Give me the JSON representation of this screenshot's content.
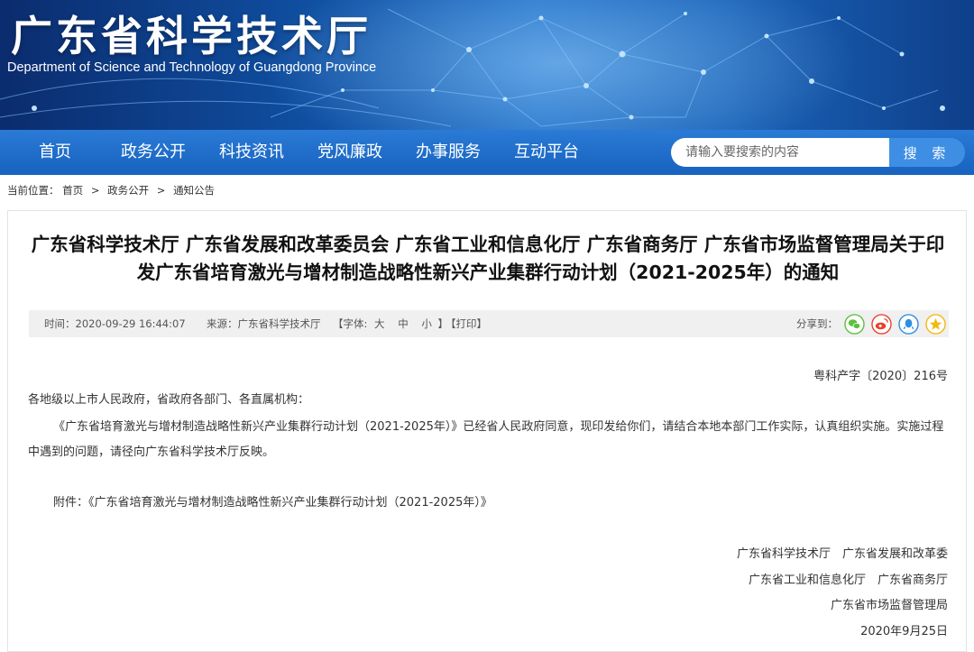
{
  "header": {
    "title": "广东省科学技术厅",
    "subtitle": "Department of Science and Technology of Guangdong Province"
  },
  "nav": {
    "items": [
      "首页",
      "政务公开",
      "科技资讯",
      "党风廉政",
      "办事服务",
      "互动平台"
    ]
  },
  "search": {
    "placeholder": "请输入要搜索的内容",
    "button_label": "搜 索"
  },
  "breadcrumb": {
    "prefix": "当前位置：",
    "items": [
      "首页",
      "政务公开",
      "通知公告"
    ],
    "separator": ">"
  },
  "article": {
    "title": "广东省科学技术厅 广东省发展和改革委员会 广东省工业和信息化厅 广东省商务厅 广东省市场监督管理局关于印发广东省培育激光与增材制造战略性新兴产业集群行动计划（2021-2025年）的通知",
    "meta": {
      "time": "时间：2020-09-29 16:44:07",
      "source": "来源：广东省科学技术厅",
      "font_prefix": "【字体:",
      "font_large": "大",
      "font_medium": "中",
      "font_small": "小",
      "font_suffix": "】",
      "print": "【打印】",
      "share_label": "分享到："
    },
    "share_icons": [
      "wechat-icon",
      "weibo-icon",
      "qq-icon",
      "qzone-icon"
    ],
    "doc_number": "粤科产字〔2020〕216号",
    "recipients": "各地级以上市人民政府，省政府各部门、各直属机构：",
    "body": "《广东省培育激光与增材制造战略性新兴产业集群行动计划（2021-2025年）》已经省人民政府同意，现印发给你们，请结合本地本部门工作实际，认真组织实施。实施过程中遇到的问题，请径向广东省科学技术厅反映。",
    "attachment": "附件：《广东省培育激光与增材制造战略性新兴产业集群行动计划（2021-2025年）》",
    "signatures": [
      "广东省科学技术厅　广东省发展和改革委",
      "广东省工业和信息化厅　广东省商务厅",
      "广东省市场监督管理局"
    ],
    "date": "2020年9月25日"
  },
  "colors": {
    "banner": "#0f4d9e",
    "nav": "#1b6ccb",
    "search_button": "#3e8fe4",
    "meta_bar": "#f0f0f0",
    "wechat": "#5cbf3e",
    "weibo": "#e6432d",
    "qq": "#2f8fe0",
    "qzone": "#f2b90f"
  }
}
